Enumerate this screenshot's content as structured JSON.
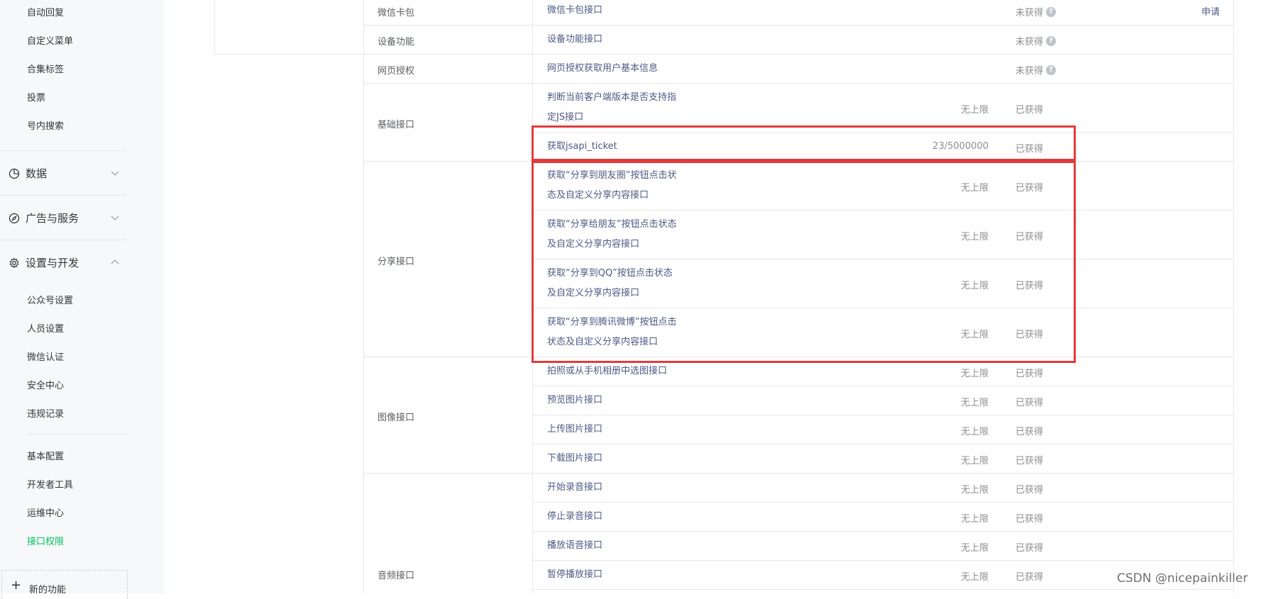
{
  "sidebar": {
    "top_items": [
      "自动回复",
      "自定义菜单",
      "合集标签",
      "投票",
      "号内搜索"
    ],
    "groups": [
      {
        "label": "数据",
        "icon": "chart-pie-icon",
        "expanded": false
      },
      {
        "label": "广告与服务",
        "icon": "compass-icon",
        "expanded": false
      },
      {
        "label": "设置与开发",
        "icon": "gear-icon",
        "expanded": true
      }
    ],
    "settings_items": [
      "公众号设置",
      "人员设置",
      "微信认证",
      "安全中心",
      "违规记录"
    ],
    "dev_items": [
      "基本配置",
      "开发者工具",
      "运维中心",
      "接口权限"
    ],
    "active_item": "接口权限",
    "new_function": "新的功能"
  },
  "table": {
    "categories": [
      "微信卡包",
      "设备功能",
      "网页授权",
      "基础接口",
      "分享接口",
      "图像接口",
      "音频接口"
    ],
    "apply_label": "申请",
    "rows": [
      {
        "name": "微信卡包接口",
        "quota": "",
        "status": "未获得",
        "help": true
      },
      {
        "name": "设备功能接口",
        "quota": "",
        "status": "未获得",
        "help": true
      },
      {
        "name": "网页授权获取用户基本信息",
        "quota": "",
        "status": "未获得",
        "help": true
      },
      {
        "name_line1": "判断当前客户端版本是否支持指",
        "name_line2": "定JS接口",
        "quota": "无上限",
        "status": "已获得"
      },
      {
        "name": "获取jsapi_ticket",
        "quota": "23/5000000",
        "status": "已获得"
      },
      {
        "name_line1": "获取“分享到朋友圈”按钮点击状",
        "name_line2": "态及自定义分享内容接口",
        "quota": "无上限",
        "status": "已获得"
      },
      {
        "name_line1": "获取“分享给朋友”按钮点击状态",
        "name_line2": "及自定义分享内容接口",
        "quota": "无上限",
        "status": "已获得"
      },
      {
        "name_line1": "获取“分享到QQ”按钮点击状态",
        "name_line2": "及自定义分享内容接口",
        "quota": "无上限",
        "status": "已获得"
      },
      {
        "name_line1": "获取“分享到腾讯微博”按钮点击",
        "name_line2": "状态及自定义分享内容接口",
        "quota": "无上限",
        "status": "已获得"
      },
      {
        "name": "拍照或从手机相册中选图接口",
        "quota": "无上限",
        "status": "已获得"
      },
      {
        "name": "预览图片接口",
        "quota": "无上限",
        "status": "已获得"
      },
      {
        "name": "上传图片接口",
        "quota": "无上限",
        "status": "已获得"
      },
      {
        "name": "下载图片接口",
        "quota": "无上限",
        "status": "已获得"
      },
      {
        "name": "开始录音接口",
        "quota": "无上限",
        "status": "已获得"
      },
      {
        "name": "停止录音接口",
        "quota": "无上限",
        "status": "已获得"
      },
      {
        "name": "播放语音接口",
        "quota": "无上限",
        "status": "已获得"
      },
      {
        "name": "暂停播放接口",
        "quota": "无上限",
        "status": "已获得"
      }
    ]
  },
  "watermark": "CSDN @nicepainkiller",
  "colors": {
    "active_green": "#07c160",
    "highlight_red": "#e33b3b",
    "link_blue": "#4d5a83"
  }
}
